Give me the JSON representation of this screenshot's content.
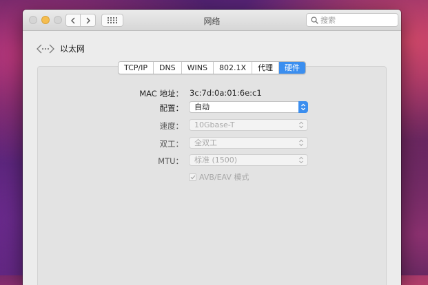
{
  "window": {
    "title": "网络"
  },
  "search": {
    "placeholder": "搜索"
  },
  "header": {
    "label": "以太网"
  },
  "tabs": [
    {
      "label": "TCP/IP",
      "active": false
    },
    {
      "label": "DNS",
      "active": false
    },
    {
      "label": "WINS",
      "active": false
    },
    {
      "label": "802.1X",
      "active": false
    },
    {
      "label": "代理",
      "active": false
    },
    {
      "label": "硬件",
      "active": true
    }
  ],
  "hardware": {
    "mac": {
      "label": "MAC 地址：",
      "value": "3c:7d:0a:01:6e:c1"
    },
    "config": {
      "label": "配置：",
      "value": "自动",
      "enabled": true
    },
    "speed": {
      "label": "速度：",
      "value": "10Gbase-T",
      "enabled": false
    },
    "duplex": {
      "label": "双工：",
      "value": "全双工",
      "enabled": false
    },
    "mtu": {
      "label": "MTU：",
      "value": "标准 (1500)",
      "enabled": false
    },
    "avb": {
      "label": "AVB/EAV 模式",
      "checked": true,
      "enabled": false
    }
  },
  "colors": {
    "accent": "#3b8eef",
    "window_bg": "#ececec"
  }
}
